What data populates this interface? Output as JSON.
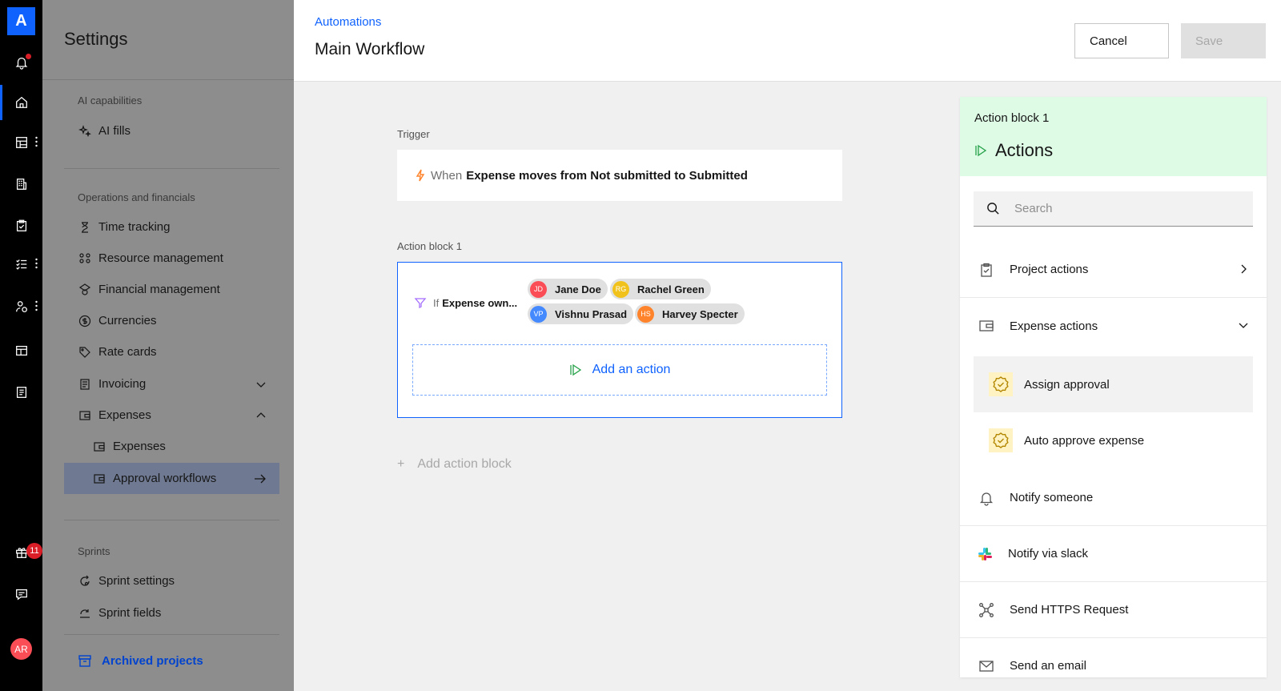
{
  "rail": {
    "logo": "A",
    "gift_badge": "11",
    "avatar_initials": "AR",
    "icons": [
      "bell-icon",
      "home-icon",
      "grid-icon",
      "building-icon",
      "clipboard-icon",
      "tasks-icon",
      "people-icon",
      "layout-icon",
      "report-icon",
      "gift-icon",
      "chat-icon"
    ]
  },
  "settings": {
    "title": "Settings",
    "sections": [
      {
        "label": "AI capabilities"
      },
      {
        "label": "Operations and financials"
      },
      {
        "label": "Sprints"
      }
    ],
    "items": {
      "ai_fills": "AI fills",
      "time_tracking": "Time tracking",
      "resource_management": "Resource management",
      "financial_management": "Financial management",
      "currencies": "Currencies",
      "rate_cards": "Rate cards",
      "invoicing": "Invoicing",
      "expenses": "Expenses",
      "expenses_sub": "Expenses",
      "approval_workflows": "Approval workflows",
      "sprint_settings": "Sprint settings",
      "sprint_fields": "Sprint fields"
    },
    "archived": "Archived projects"
  },
  "header": {
    "breadcrumb": "Automations",
    "title": "Main Workflow",
    "cancel": "Cancel",
    "save": "Save"
  },
  "canvas": {
    "trigger_label": "Trigger",
    "trigger_when": "When",
    "trigger_condition": "Expense moves from Not submitted to Submitted",
    "action_block_label": "Action block 1",
    "if_label": "If",
    "if_field": "Expense own...",
    "people": [
      {
        "initials": "JD",
        "name": "Jane Doe",
        "color": "#fa4d56"
      },
      {
        "initials": "RG",
        "name": "Rachel Green",
        "color": "#f1c21b"
      },
      {
        "initials": "VP",
        "name": "Vishnu Prasad",
        "color": "#4589ff"
      },
      {
        "initials": "HS",
        "name": "Harvey Specter",
        "color": "#ff832b"
      }
    ],
    "add_action": "Add an action",
    "add_action_block_plus": "+",
    "add_action_block": "Add action block"
  },
  "panel": {
    "subtitle": "Action block 1",
    "title": "Actions",
    "search_placeholder": "Search",
    "project_actions": "Project actions",
    "expense_actions": "Expense actions",
    "assign_approval": "Assign approval",
    "auto_approve": "Auto approve expense",
    "notify_someone": "Notify someone",
    "notify_slack": "Notify via slack",
    "send_https": "Send HTTPS Request",
    "send_email": "Send an email"
  },
  "colors": {
    "accent": "#0f62fe",
    "panel_header": "#defbe6",
    "trigger_icon": "#ff832b",
    "approval_badge": "#fff3c4"
  }
}
